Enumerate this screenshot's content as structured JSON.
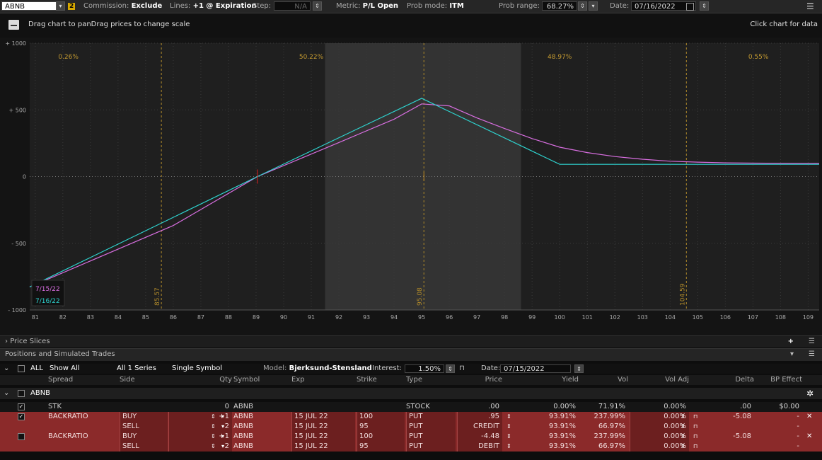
{
  "toolbar": {
    "symbol": "ABNB",
    "badge": "2",
    "commission_label": "Commission:",
    "commission_value": "Exclude",
    "lines_label": "Lines:",
    "lines_value": "+1 @ Expiration",
    "step_label": "Step:",
    "step_value": "N/A",
    "metric_label": "Metric:",
    "metric_value": "P/L Open",
    "prob_mode_label": "Prob mode:",
    "prob_mode_value": "ITM",
    "prob_range_label": "Prob range:",
    "prob_range_value": "68.27%",
    "date_label": "Date:",
    "date_value": "07/16/2022"
  },
  "chart_header": {
    "hint_left": "Drag chart to panDrag prices to change scale",
    "hint_right": "Click chart for data"
  },
  "chart_data": {
    "type": "line",
    "xlim": [
      80.8,
      109.4
    ],
    "ylim": [
      -1000,
      1000
    ],
    "x_ticks": [
      "81",
      "82",
      "83",
      "84",
      "85",
      "86",
      "87",
      "88",
      "89",
      "90",
      "91",
      "92",
      "93",
      "94",
      "95",
      "96",
      "97",
      "98",
      "99",
      "100",
      "101",
      "102",
      "103",
      "104",
      "105",
      "106",
      "107",
      "108",
      "109"
    ],
    "y_ticks": [
      {
        "v": 1000,
        "label": "+ 1000"
      },
      {
        "v": 500,
        "label": "+ 500"
      },
      {
        "v": 0,
        "label": "0"
      },
      {
        "v": -500,
        "label": "- 500"
      },
      {
        "v": -1000,
        "label": "- 1000"
      }
    ],
    "shade_band": [
      91.5,
      98.6
    ],
    "vlines": [
      {
        "x": 85.57,
        "label": "85.57"
      },
      {
        "x": 95.08,
        "label": "95.08"
      },
      {
        "x": 104.59,
        "label": "104.59"
      }
    ],
    "prob_labels": [
      {
        "x": 82.2,
        "label": "0.26%"
      },
      {
        "x": 91.0,
        "label": "50.22%"
      },
      {
        "x": 100.0,
        "label": "48.97%"
      },
      {
        "x": 107.2,
        "label": "0.55%"
      }
    ],
    "breakeven": 89.05,
    "current_price": 95.08,
    "series": [
      {
        "name": "7/15/22",
        "color": "#d86ee0",
        "points": [
          [
            80.8,
            -827
          ],
          [
            86,
            -367
          ],
          [
            89.05,
            0
          ],
          [
            92,
            255
          ],
          [
            94,
            430
          ],
          [
            95,
            545
          ],
          [
            96,
            530
          ],
          [
            97,
            440
          ],
          [
            98,
            360
          ],
          [
            99,
            285
          ],
          [
            100,
            220
          ],
          [
            101,
            180
          ],
          [
            102,
            150
          ],
          [
            103,
            130
          ],
          [
            104,
            115
          ],
          [
            105,
            108
          ],
          [
            106,
            103
          ],
          [
            107,
            101
          ],
          [
            109.4,
            98
          ]
        ]
      },
      {
        "name": "7/16/22",
        "color": "#2ed4d0",
        "points": [
          [
            80.8,
            -827
          ],
          [
            89.05,
            0
          ],
          [
            95,
            587
          ],
          [
            100,
            92
          ],
          [
            109.4,
            92
          ]
        ]
      }
    ]
  },
  "panels": {
    "price_slices": "Price Slices",
    "positions": "Positions and Simulated Trades"
  },
  "filters": {
    "all": "ALL",
    "show_all": "Show All",
    "series": "All 1 Series",
    "symbol_mode": "Single Symbol",
    "model_label": "Model:",
    "model_value": "Bjerksund-Stensland",
    "interest_label": "Interest:",
    "interest_value": "1.50%",
    "date_label": "Date:",
    "date_value": "07/15/2022"
  },
  "columns": [
    "Spread",
    "Side",
    "Qty",
    "Symbol",
    "Exp",
    "Strike",
    "Type",
    "Price",
    "Yield",
    "Vol",
    "Vol Adj",
    "Delta",
    "BP Effect"
  ],
  "group": "ABNB",
  "rows": [
    {
      "spread": "STK",
      "side": "",
      "qty": "0",
      "symbol": "ABNB",
      "exp": "",
      "strike": "",
      "type": "STOCK",
      "price": ".00",
      "yield": "0.00%",
      "vol": "71.91%",
      "voladj": "0.00%",
      "delta": ".00",
      "bp": "$0.00",
      "red": false
    },
    {
      "spread": "BACKRATIO",
      "side": "BUY",
      "qty": "+1",
      "symbol": "ABNB",
      "exp": "15 JUL 22",
      "strike": "100",
      "type": "PUT",
      "price": ".95",
      "yield": "93.91%",
      "vol": "237.99%",
      "voladj": "0.00%",
      "delta": "-5.08",
      "bp": "-",
      "red": true
    },
    {
      "spread": "",
      "side": "SELL",
      "qty": "-2",
      "symbol": "ABNB",
      "exp": "15 JUL 22",
      "strike": "95",
      "type": "PUT",
      "price": "CREDIT",
      "yield": "93.91%",
      "vol": "66.97%",
      "voladj": "0.00%",
      "delta": "",
      "bp": "-",
      "red": true
    },
    {
      "spread": "BACKRATIO",
      "side": "BUY",
      "qty": "+1",
      "symbol": "ABNB",
      "exp": "15 JUL 22",
      "strike": "100",
      "type": "PUT",
      "price": "-4.48",
      "yield": "93.91%",
      "vol": "237.99%",
      "voladj": "0.00%",
      "delta": "-5.08",
      "bp": "-",
      "red": true
    },
    {
      "spread": "",
      "side": "SELL",
      "qty": "-2",
      "symbol": "ABNB",
      "exp": "15 JUL 22",
      "strike": "95",
      "type": "PUT",
      "price": "DEBIT",
      "yield": "93.91%",
      "vol": "66.97%",
      "voladj": "0.00%",
      "delta": "",
      "bp": "-",
      "red": true
    }
  ]
}
